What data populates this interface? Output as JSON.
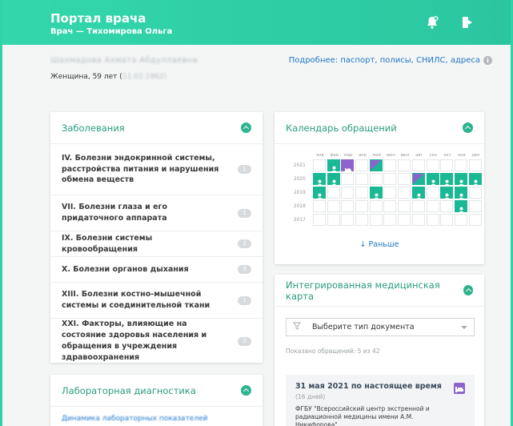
{
  "header": {
    "title": "Портал врача",
    "subtitle": "Врач — Тихомирова Ольга",
    "bell_icon": "bell-icon",
    "logout_icon": "logout-icon"
  },
  "patient": {
    "name_redacted": "Шахмадова Ахмата Абдуллаевна",
    "info_prefix": "Женщина, 59 лет (",
    "birth_redacted": "11.02.1962",
    "info_suffix": ")",
    "more_link": "Подробнее: паспорт, полисы, СНИЛС, адреса"
  },
  "diseases": {
    "title": "Заболевания",
    "items": [
      {
        "label": "IV. Болезни эндокринной системы, расстройства питания и нарушения обмена веществ",
        "count": "1"
      },
      {
        "label": "VII. Болезни глаза и его придаточного аппарата",
        "count": "1"
      },
      {
        "label": "IX. Болезни системы кровообращения",
        "count": "2"
      },
      {
        "label": "X. Болезни органов дыхания",
        "count": "3"
      },
      {
        "label": "XIII. Болезни костно-мышечной системы и соединительной ткани",
        "count": "1"
      },
      {
        "label": "XXI. Факторы, влияющие на состояние здоровья населения и обращения в учреждения здравоохранения",
        "count": "3"
      }
    ]
  },
  "lab": {
    "title": "Лабораторная диагностика",
    "link": "Динамика лабораторных показателей"
  },
  "calendar": {
    "title": "Календарь обращений",
    "months": [
      "янв",
      "фев",
      "мар",
      "апр",
      "май",
      "июн",
      "июл",
      "авг",
      "сен",
      "окт",
      "ноя",
      "дек"
    ],
    "rows": [
      {
        "year": "2021",
        "cells": [
          ".",
          "d",
          "h",
          ".",
          "m",
          ".",
          ".",
          ".",
          ".",
          ".",
          ".",
          "."
        ]
      },
      {
        "year": "2020",
        "cells": [
          "d",
          "d",
          ".",
          ".",
          ".",
          ".",
          ".",
          "m",
          "d",
          "d",
          "d",
          "d"
        ]
      },
      {
        "year": "2019",
        "cells": [
          "d",
          ".",
          ".",
          ".",
          "d",
          ".",
          ".",
          "d",
          ".",
          "d",
          "d",
          "."
        ]
      },
      {
        "year": "2018",
        "cells": [
          ".",
          ".",
          ".",
          ".",
          ".",
          ".",
          ".",
          ".",
          ".",
          ".",
          "d",
          "."
        ]
      },
      {
        "year": "2017",
        "cells": [
          ".",
          ".",
          ".",
          ".",
          ".",
          ".",
          ".",
          ".",
          ".",
          ".",
          ".",
          "."
        ]
      }
    ],
    "earlier": "↓ Раньше"
  },
  "emr": {
    "title": "Интегрированная медицинская карта",
    "select_placeholder": "Выберите тип документа",
    "shown": "Показано обращений: 5 из 42",
    "episode": {
      "title": "31 мая 2021 по настоящее время",
      "days": "(16 дней)",
      "org": "ФГБУ \"Всероссийский центр экстренной и радиационной медицины имени А.М. Никифорова\""
    }
  }
}
